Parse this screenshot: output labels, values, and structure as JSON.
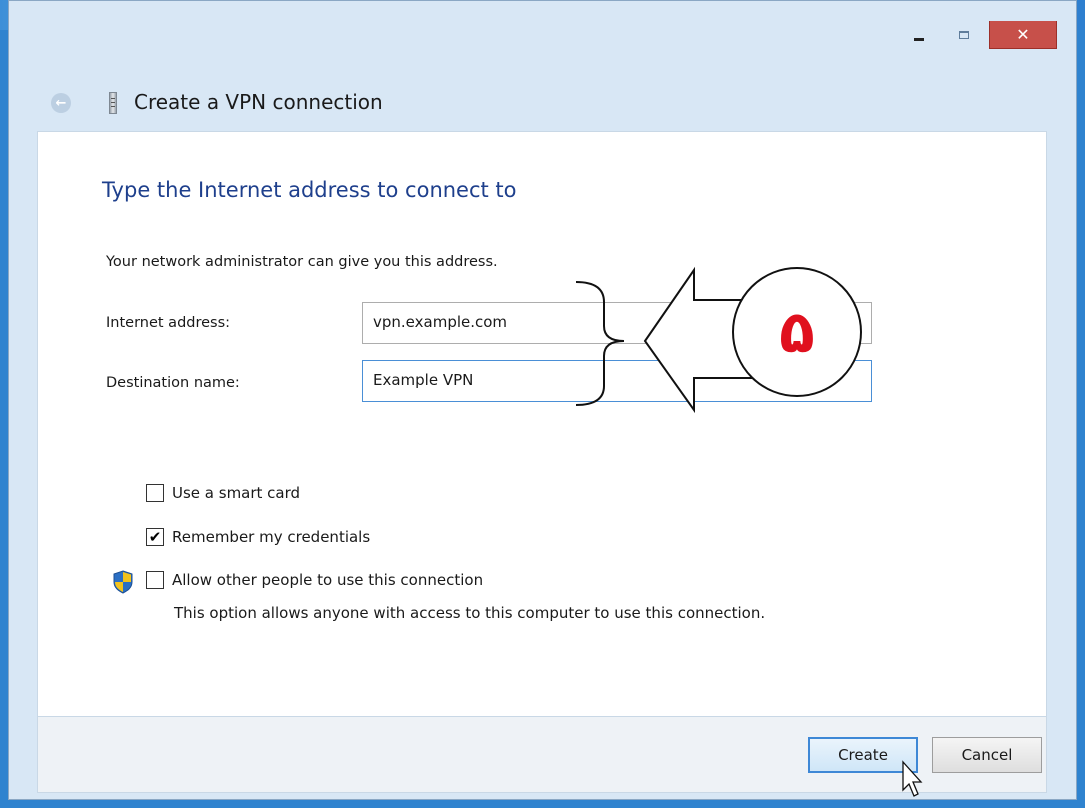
{
  "window": {
    "title": "Create a VPN connection",
    "minimize_icon": "minimize-icon",
    "maximize_icon": "maximize-icon",
    "close_glyph": "✕",
    "back_icon": "back-arrow-icon"
  },
  "page": {
    "heading": "Type the Internet address to connect to",
    "description": "Your network administrator can give you this address.",
    "internet_address_label": "Internet address:",
    "internet_address_value": "vpn.example.com",
    "destination_label": "Destination name:",
    "destination_value": "Example VPN"
  },
  "options": {
    "smart_card": {
      "label": "Use a smart card",
      "checked": false
    },
    "remember": {
      "label": "Remember my credentials",
      "checked": true,
      "mark": "✔"
    },
    "allow_others": {
      "label": "Allow other people to use this connection",
      "checked": false
    },
    "allow_note": "This option allows anyone with access to this computer to use this connection."
  },
  "footer": {
    "create_label": "Create",
    "cancel_label": "Cancel"
  },
  "annotation": {
    "step_label": "۵",
    "color": "#e0101e"
  },
  "colors": {
    "heading": "#1e3f8c",
    "close_button": "#c7504a",
    "focus_border": "#4a8fd6"
  }
}
